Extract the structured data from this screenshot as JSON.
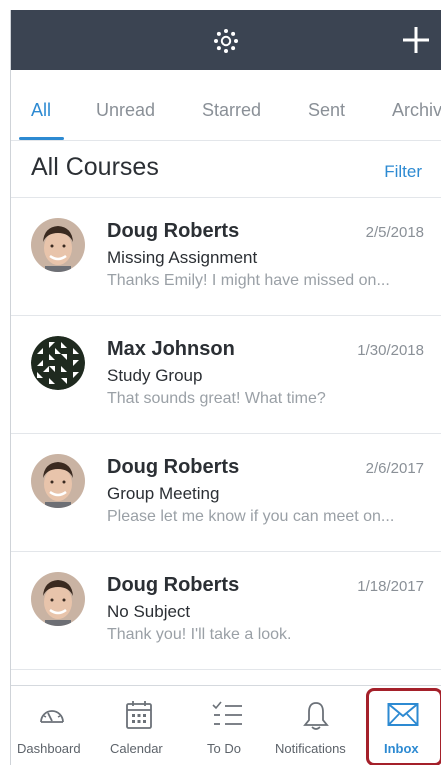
{
  "header": {
    "logo_icon": "canvas-logo-icon",
    "compose_icon": "plus-icon"
  },
  "tabs": [
    {
      "label": "All",
      "active": true
    },
    {
      "label": "Unread",
      "active": false
    },
    {
      "label": "Starred",
      "active": false
    },
    {
      "label": "Sent",
      "active": false
    },
    {
      "label": "Archiv",
      "active": false
    }
  ],
  "section": {
    "title": "All Courses",
    "filter_label": "Filter"
  },
  "messages": [
    {
      "sender": "Doug Roberts",
      "date": "2/5/2018",
      "subject": "Missing Assignment",
      "preview": "Thanks Emily! I might have missed on...",
      "avatar": "photo"
    },
    {
      "sender": "Max Johnson",
      "date": "1/30/2018",
      "subject": "Study Group",
      "preview": "That sounds great! What time?",
      "avatar": "pattern"
    },
    {
      "sender": "Doug Roberts",
      "date": "2/6/2017",
      "subject": "Group Meeting",
      "preview": "Please let me know if you can meet on...",
      "avatar": "photo"
    },
    {
      "sender": "Doug Roberts",
      "date": "1/18/2017",
      "subject": "No Subject",
      "preview": "Thank you! I'll take a look.",
      "avatar": "photo"
    }
  ],
  "bottom_nav": [
    {
      "label": "Dashboard",
      "icon": "dashboard-icon"
    },
    {
      "label": "Calendar",
      "icon": "calendar-icon"
    },
    {
      "label": "To Do",
      "icon": "todo-icon"
    },
    {
      "label": "Notifications",
      "icon": "bell-icon"
    },
    {
      "label": "Inbox",
      "icon": "inbox-icon",
      "active": true
    }
  ],
  "colors": {
    "header_bg": "#3b4452",
    "accent": "#2d8ad2",
    "highlight_border": "#a4202a"
  }
}
